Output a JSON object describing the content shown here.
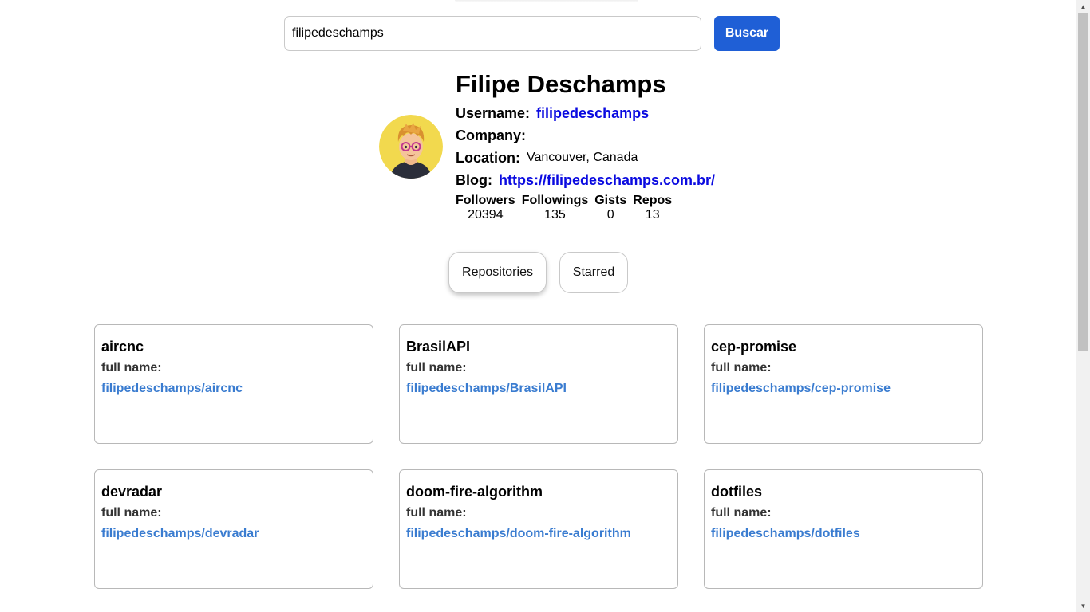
{
  "search": {
    "value": "filipedeschamps",
    "button_label": "Buscar"
  },
  "profile": {
    "name": "Filipe Deschamps",
    "username_label": "Username:",
    "username": "filipedeschamps",
    "company_label": "Company:",
    "company": "",
    "location_label": "Location:",
    "location": "Vancouver, Canada",
    "blog_label": "Blog:",
    "blog": "https://filipedeschamps.com.br/"
  },
  "stats": [
    {
      "label": "Followers",
      "value": "20394"
    },
    {
      "label": "Followings",
      "value": "135"
    },
    {
      "label": "Gists",
      "value": "0"
    },
    {
      "label": "Repos",
      "value": "13"
    }
  ],
  "tabs": [
    {
      "label": "Repositories",
      "active": true
    },
    {
      "label": "Starred",
      "active": false
    }
  ],
  "repos": [
    {
      "name": "aircnc",
      "full_name_label": "full name:",
      "full_name": "filipedeschamps/aircnc"
    },
    {
      "name": "BrasilAPI",
      "full_name_label": "full name:",
      "full_name": "filipedeschamps/BrasilAPI"
    },
    {
      "name": "cep-promise",
      "full_name_label": "full name:",
      "full_name": "filipedeschamps/cep-promise"
    },
    {
      "name": "devradar",
      "full_name_label": "full name:",
      "full_name": "filipedeschamps/devradar"
    },
    {
      "name": "doom-fire-algorithm",
      "full_name_label": "full name:",
      "full_name": "filipedeschamps/doom-fire-algorithm"
    },
    {
      "name": "dotfiles",
      "full_name_label": "full name:",
      "full_name": "filipedeschamps/dotfiles"
    }
  ],
  "colors": {
    "accent": "#1f5fd6",
    "profile_link": "#0a0ae0",
    "repo_link": "#3a7cd0",
    "avatar_background": "#f2d94e"
  },
  "icons": {
    "avatar": "cartoon-avatar-image",
    "scroll_up": "triangle-up",
    "scroll_down": "triangle-down"
  }
}
